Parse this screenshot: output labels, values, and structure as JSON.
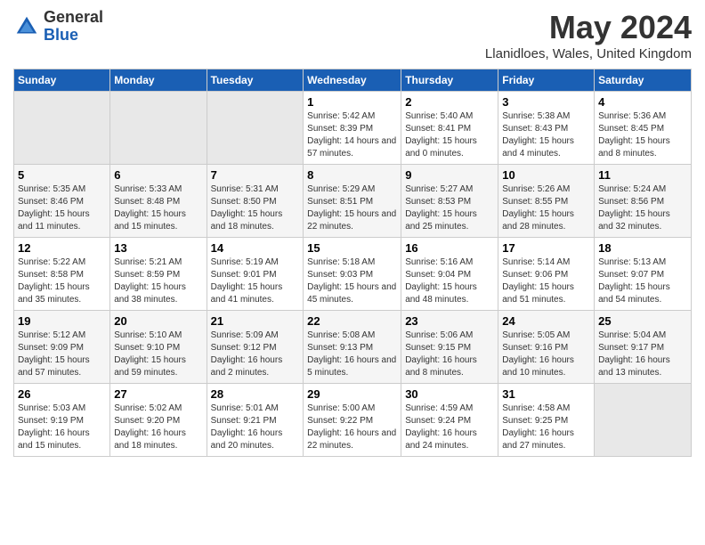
{
  "logo": {
    "general": "General",
    "blue": "Blue"
  },
  "header": {
    "month": "May 2024",
    "location": "Llanidloes, Wales, United Kingdom"
  },
  "days_of_week": [
    "Sunday",
    "Monday",
    "Tuesday",
    "Wednesday",
    "Thursday",
    "Friday",
    "Saturday"
  ],
  "weeks": [
    [
      {
        "num": "",
        "empty": true
      },
      {
        "num": "",
        "empty": true
      },
      {
        "num": "",
        "empty": true
      },
      {
        "num": "1",
        "sunrise": "5:42 AM",
        "sunset": "8:39 PM",
        "daylight": "14 hours and 57 minutes."
      },
      {
        "num": "2",
        "sunrise": "5:40 AM",
        "sunset": "8:41 PM",
        "daylight": "15 hours and 0 minutes."
      },
      {
        "num": "3",
        "sunrise": "5:38 AM",
        "sunset": "8:43 PM",
        "daylight": "15 hours and 4 minutes."
      },
      {
        "num": "4",
        "sunrise": "5:36 AM",
        "sunset": "8:45 PM",
        "daylight": "15 hours and 8 minutes."
      }
    ],
    [
      {
        "num": "5",
        "sunrise": "5:35 AM",
        "sunset": "8:46 PM",
        "daylight": "15 hours and 11 minutes."
      },
      {
        "num": "6",
        "sunrise": "5:33 AM",
        "sunset": "8:48 PM",
        "daylight": "15 hours and 15 minutes."
      },
      {
        "num": "7",
        "sunrise": "5:31 AM",
        "sunset": "8:50 PM",
        "daylight": "15 hours and 18 minutes."
      },
      {
        "num": "8",
        "sunrise": "5:29 AM",
        "sunset": "8:51 PM",
        "daylight": "15 hours and 22 minutes."
      },
      {
        "num": "9",
        "sunrise": "5:27 AM",
        "sunset": "8:53 PM",
        "daylight": "15 hours and 25 minutes."
      },
      {
        "num": "10",
        "sunrise": "5:26 AM",
        "sunset": "8:55 PM",
        "daylight": "15 hours and 28 minutes."
      },
      {
        "num": "11",
        "sunrise": "5:24 AM",
        "sunset": "8:56 PM",
        "daylight": "15 hours and 32 minutes."
      }
    ],
    [
      {
        "num": "12",
        "sunrise": "5:22 AM",
        "sunset": "8:58 PM",
        "daylight": "15 hours and 35 minutes."
      },
      {
        "num": "13",
        "sunrise": "5:21 AM",
        "sunset": "8:59 PM",
        "daylight": "15 hours and 38 minutes."
      },
      {
        "num": "14",
        "sunrise": "5:19 AM",
        "sunset": "9:01 PM",
        "daylight": "15 hours and 41 minutes."
      },
      {
        "num": "15",
        "sunrise": "5:18 AM",
        "sunset": "9:03 PM",
        "daylight": "15 hours and 45 minutes."
      },
      {
        "num": "16",
        "sunrise": "5:16 AM",
        "sunset": "9:04 PM",
        "daylight": "15 hours and 48 minutes."
      },
      {
        "num": "17",
        "sunrise": "5:14 AM",
        "sunset": "9:06 PM",
        "daylight": "15 hours and 51 minutes."
      },
      {
        "num": "18",
        "sunrise": "5:13 AM",
        "sunset": "9:07 PM",
        "daylight": "15 hours and 54 minutes."
      }
    ],
    [
      {
        "num": "19",
        "sunrise": "5:12 AM",
        "sunset": "9:09 PM",
        "daylight": "15 hours and 57 minutes."
      },
      {
        "num": "20",
        "sunrise": "5:10 AM",
        "sunset": "9:10 PM",
        "daylight": "15 hours and 59 minutes."
      },
      {
        "num": "21",
        "sunrise": "5:09 AM",
        "sunset": "9:12 PM",
        "daylight": "16 hours and 2 minutes."
      },
      {
        "num": "22",
        "sunrise": "5:08 AM",
        "sunset": "9:13 PM",
        "daylight": "16 hours and 5 minutes."
      },
      {
        "num": "23",
        "sunrise": "5:06 AM",
        "sunset": "9:15 PM",
        "daylight": "16 hours and 8 minutes."
      },
      {
        "num": "24",
        "sunrise": "5:05 AM",
        "sunset": "9:16 PM",
        "daylight": "16 hours and 10 minutes."
      },
      {
        "num": "25",
        "sunrise": "5:04 AM",
        "sunset": "9:17 PM",
        "daylight": "16 hours and 13 minutes."
      }
    ],
    [
      {
        "num": "26",
        "sunrise": "5:03 AM",
        "sunset": "9:19 PM",
        "daylight": "16 hours and 15 minutes."
      },
      {
        "num": "27",
        "sunrise": "5:02 AM",
        "sunset": "9:20 PM",
        "daylight": "16 hours and 18 minutes."
      },
      {
        "num": "28",
        "sunrise": "5:01 AM",
        "sunset": "9:21 PM",
        "daylight": "16 hours and 20 minutes."
      },
      {
        "num": "29",
        "sunrise": "5:00 AM",
        "sunset": "9:22 PM",
        "daylight": "16 hours and 22 minutes."
      },
      {
        "num": "30",
        "sunrise": "4:59 AM",
        "sunset": "9:24 PM",
        "daylight": "16 hours and 24 minutes."
      },
      {
        "num": "31",
        "sunrise": "4:58 AM",
        "sunset": "9:25 PM",
        "daylight": "16 hours and 27 minutes."
      },
      {
        "num": "",
        "empty": true
      }
    ]
  ]
}
